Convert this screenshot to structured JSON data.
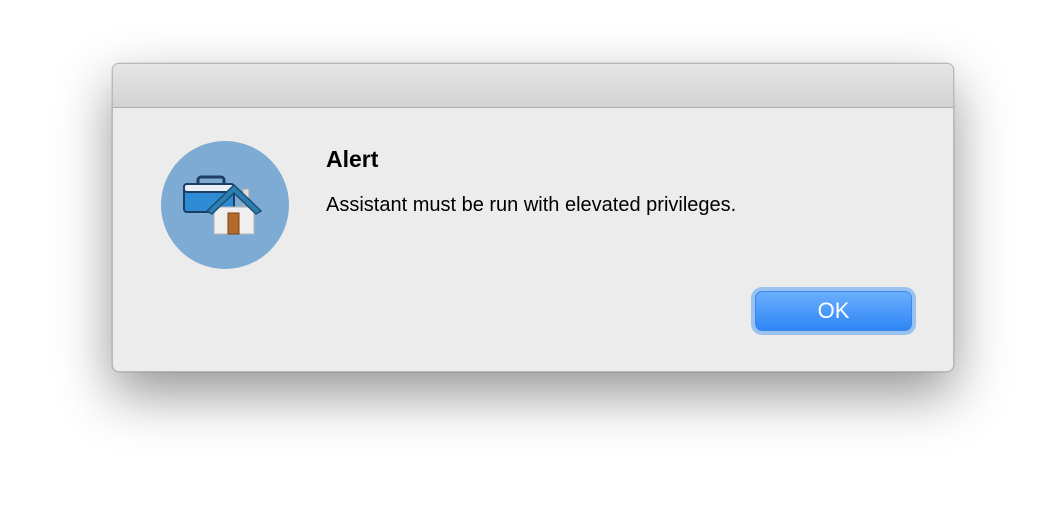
{
  "dialog": {
    "title": "Alert",
    "message": "Assistant must be run with elevated privileges.",
    "ok_label": "OK",
    "icon": "assistant-app-icon"
  },
  "colors": {
    "accent": "#3a8ef6",
    "icon_circle": "#7eabd3"
  }
}
